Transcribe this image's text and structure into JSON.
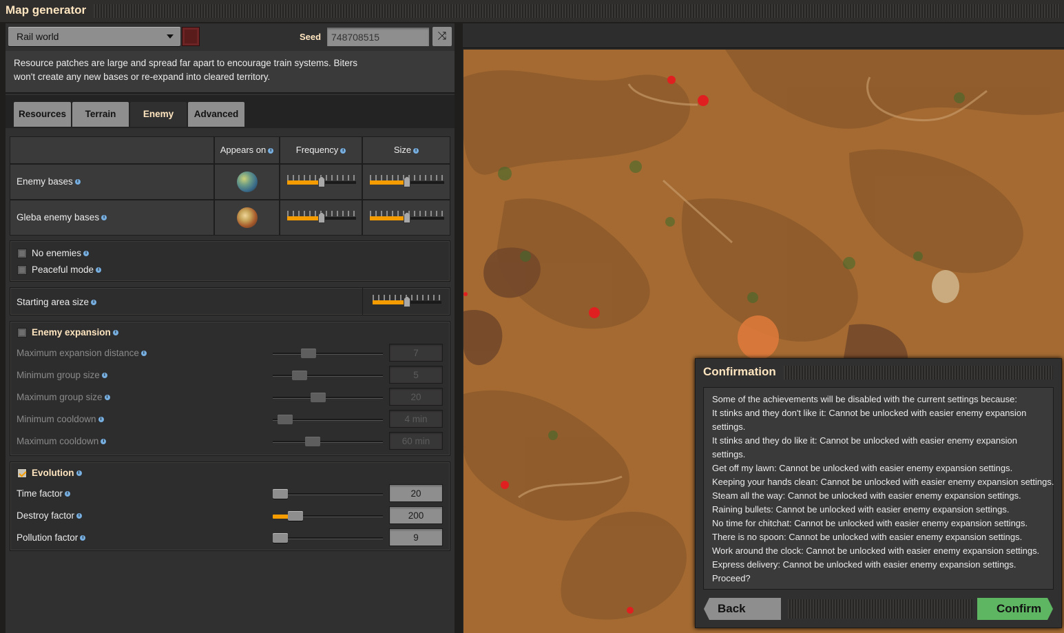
{
  "window": {
    "title": "Map generator"
  },
  "preset": {
    "selected": "Rail world"
  },
  "seed": {
    "label": "Seed",
    "value": "748708515"
  },
  "description": {
    "lines": [
      "Resource patches are large and spread far apart to encourage train systems. Biters",
      "won't create any new bases or re-expand into cleared territory."
    ]
  },
  "tabs": [
    {
      "label": "Resources",
      "active": false
    },
    {
      "label": "Terrain",
      "active": false
    },
    {
      "label": "Enemy",
      "active": true
    },
    {
      "label": "Advanced",
      "active": false
    }
  ],
  "enemy_table": {
    "headers": {
      "appears_on": "Appears on",
      "frequency": "Frequency",
      "size": "Size"
    },
    "rows": [
      {
        "label": "Enemy bases",
        "planet_icon": "nauvis-planet-icon",
        "frequency_level": 0.5,
        "size_level": 0.5
      },
      {
        "label": "Gleba enemy bases",
        "planet_icon": "gleba-planet-icon",
        "frequency_level": 0.5,
        "size_level": 0.5
      }
    ]
  },
  "options": {
    "no_enemies": {
      "label": "No enemies",
      "checked": false
    },
    "peaceful_mode": {
      "label": "Peaceful mode",
      "checked": false
    }
  },
  "starting_area": {
    "label": "Starting area size",
    "level": 0.5
  },
  "expansion": {
    "label": "Enemy expansion",
    "checked": false,
    "rows": [
      {
        "label": "Maximum expansion distance",
        "value": "7",
        "level": 0.3
      },
      {
        "label": "Minimum group size",
        "value": "5",
        "level": 0.2
      },
      {
        "label": "Maximum group size",
        "value": "20",
        "level": 0.4
      },
      {
        "label": "Minimum cooldown",
        "value": "4 min",
        "level": 0.05
      },
      {
        "label": "Maximum cooldown",
        "value": "60 min",
        "level": 0.34
      }
    ]
  },
  "evolution": {
    "label": "Evolution",
    "checked": true,
    "rows": [
      {
        "label": "Time factor",
        "value": "20",
        "level": 0.0
      },
      {
        "label": "Destroy factor",
        "value": "200",
        "level": 0.16
      },
      {
        "label": "Pollution factor",
        "value": "9",
        "level": 0.0
      }
    ]
  },
  "colors": {
    "accent": "#f49c00",
    "confirm": "#5eb663",
    "heading": "#ffe6c0",
    "map_ground": "#a46a32"
  },
  "confirmation": {
    "title": "Confirmation",
    "lines": [
      "Some of the achievements will be disabled with the current settings because:",
      "It stinks and they don't like it: Cannot be unlocked with easier enemy expansion",
      "settings.",
      "It stinks and they do like it: Cannot be unlocked with easier enemy expansion",
      "settings.",
      "Get off my lawn: Cannot be unlocked with easier enemy expansion settings.",
      "Keeping your hands clean: Cannot be unlocked with easier enemy expansion settings.",
      "Steam all the way: Cannot be unlocked with easier enemy expansion settings.",
      "Raining bullets: Cannot be unlocked with easier enemy expansion settings.",
      "No time for chitchat: Cannot be unlocked with easier enemy expansion settings.",
      "There is no spoon: Cannot be unlocked with easier enemy expansion settings.",
      "Work around the clock: Cannot be unlocked with easier enemy expansion settings.",
      "Express delivery: Cannot be unlocked with easier enemy expansion settings.",
      "Proceed?"
    ],
    "back_label": "Back",
    "confirm_label": "Confirm"
  }
}
